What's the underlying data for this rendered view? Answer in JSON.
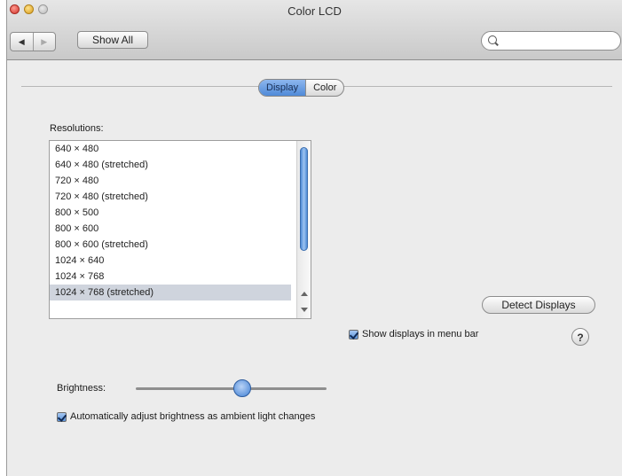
{
  "window": {
    "title": "Color LCD"
  },
  "toolbar": {
    "back_icon": "back-arrow-icon",
    "forward_icon": "forward-arrow-icon",
    "show_all_label": "Show All",
    "search_value": "",
    "search_placeholder": ""
  },
  "tabs": [
    {
      "label": "Display",
      "active": true
    },
    {
      "label": "Color",
      "active": false
    }
  ],
  "resolutions": {
    "label": "Resolutions:",
    "items": [
      "640 × 480",
      "640 × 480 (stretched)",
      "720 × 480",
      "720 × 480 (stretched)",
      "800 × 500",
      "800 × 600",
      "800 × 600 (stretched)",
      "1024 × 640",
      "1024 × 768",
      "1024 × 768 (stretched)"
    ],
    "selected_index": 9
  },
  "buttons": {
    "detect_displays": "Detect Displays"
  },
  "options": {
    "show_displays_menu_bar": "Show displays in menu bar",
    "auto_brightness": "Automatically adjust brightness as ambient light changes"
  },
  "brightness": {
    "label": "Brightness:",
    "level": 0.57
  },
  "help": {
    "label": "?"
  },
  "colors": {
    "accent": "#4f8ad8",
    "selection": "#cfd4dd"
  }
}
